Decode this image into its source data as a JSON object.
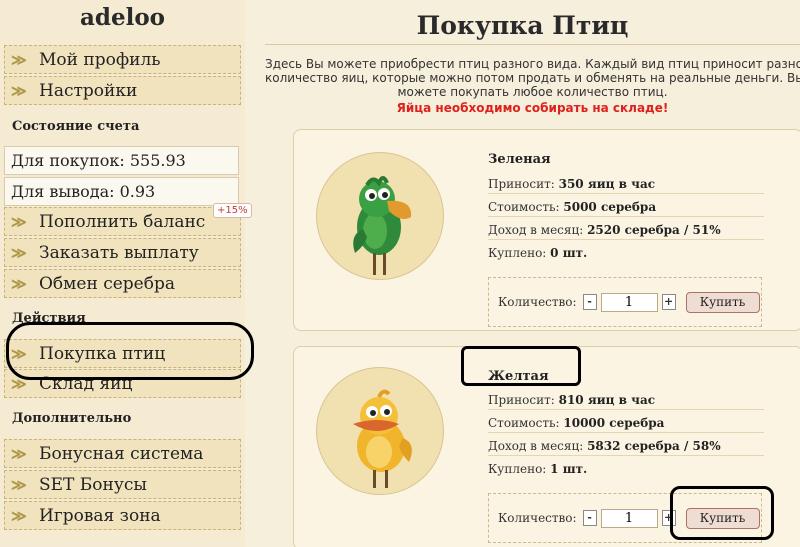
{
  "sidebar": {
    "username": "adeloo",
    "menu_top": [
      {
        "label": "Мой профиль"
      },
      {
        "label": "Настройки"
      }
    ],
    "account_section_title": "Состояние счета",
    "balance_purchase": "Для покупок: 555.93",
    "balance_withdraw": "Для вывода: 0.93",
    "bonus_badge": "+15%",
    "menu_account": [
      {
        "label": "Пополнить баланс"
      },
      {
        "label": "Заказать выплату"
      },
      {
        "label": "Обмен серебра"
      }
    ],
    "actions_section_title": "Действия",
    "menu_actions": [
      {
        "label": "Покупка птиц"
      },
      {
        "label": "Склад яиц"
      }
    ],
    "extra_section_title": "Дополнительно",
    "menu_extra": [
      {
        "label": "Бонусная система"
      },
      {
        "label": "SET Бонусы"
      },
      {
        "label": "Игровая зона"
      }
    ]
  },
  "main": {
    "title": "Покупка Птиц",
    "intro_lines": [
      "Здесь Вы можете приобрести птиц разного вида. Каждый вид птиц приносит разное",
      "количество яиц, которые можно потом продать и обменять на реальные деньги. Вы",
      "можете покупать любое количество птиц."
    ],
    "notice": "Яйца необходимо собирать на складе!",
    "birds": [
      {
        "name": "Зеленая",
        "yield_label": "Приносит:",
        "yield_value": "350 яиц в час",
        "cost_label": "Стоимость:",
        "cost_value": "5000 серебра",
        "income_label": "Доход в месяц:",
        "income_value": "2520 серебра / 51%",
        "bought_label": "Куплено:",
        "bought_value": "0 шт.",
        "qty_label": "Количество:",
        "qty_value": "1",
        "minus": "-",
        "plus": "+",
        "buy_label": "Купить",
        "body_color": "#2f8a3c"
      },
      {
        "name": "Желтая",
        "yield_label": "Приносит:",
        "yield_value": "810 яиц в час",
        "cost_label": "Стоимость:",
        "cost_value": "10000 серебра",
        "income_label": "Доход в месяц:",
        "income_value": "5832 серебра / 58%",
        "bought_label": "Куплено:",
        "bought_value": "1 шт.",
        "qty_label": "Количество:",
        "qty_value": "1",
        "minus": "-",
        "plus": "+",
        "buy_label": "Купить",
        "body_color": "#f0b52a"
      }
    ]
  },
  "icons": {
    "menu_chevron": "double-chevron-right-icon"
  },
  "colors": {
    "notice": "#e0201c",
    "badge": "#c43a3a",
    "accent_chevron": "#b09648"
  }
}
